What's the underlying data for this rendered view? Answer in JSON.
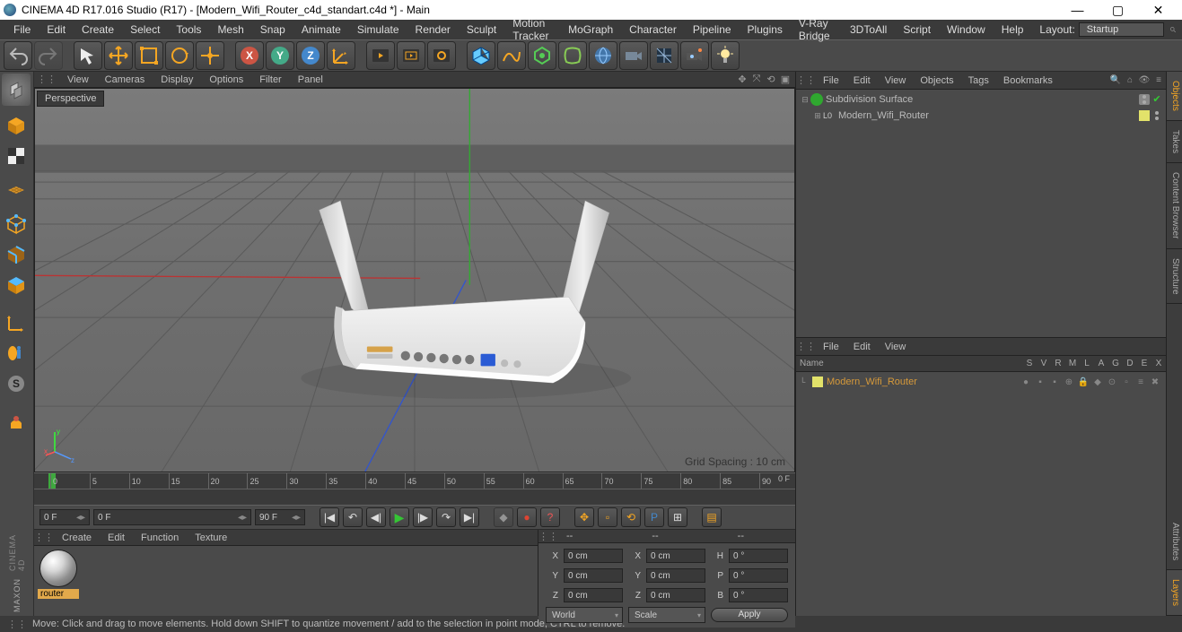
{
  "titlebar": {
    "text": "CINEMA 4D R17.016 Studio (R17) - [Modern_Wifi_Router_c4d_standart.c4d *] - Main"
  },
  "menubar": {
    "items": [
      "File",
      "Edit",
      "Create",
      "Select",
      "Tools",
      "Mesh",
      "Snap",
      "Animate",
      "Simulate",
      "Render",
      "Sculpt",
      "Motion Tracker",
      "MoGraph",
      "Character",
      "Pipeline",
      "Plugins",
      "V-Ray Bridge",
      "3DToAll",
      "Script",
      "Window",
      "Help"
    ],
    "layout_label": "Layout:",
    "layout_value": "Startup"
  },
  "viewport": {
    "menus": [
      "View",
      "Cameras",
      "Display",
      "Options",
      "Filter",
      "Panel"
    ],
    "label": "Perspective",
    "grid_info": "Grid Spacing : 10 cm"
  },
  "timeline": {
    "ticks": [
      "0",
      "5",
      "10",
      "15",
      "20",
      "25",
      "30",
      "35",
      "40",
      "45",
      "50",
      "55",
      "60",
      "65",
      "70",
      "75",
      "80",
      "85",
      "90"
    ],
    "end_label": "0 F",
    "frame_start": "0 F",
    "frame_slider": "0 F",
    "frame_end": "90 F"
  },
  "materials": {
    "menus": [
      "Create",
      "Edit",
      "Function",
      "Texture"
    ],
    "items": [
      {
        "name": "router"
      }
    ]
  },
  "coords": {
    "header": "--",
    "header2": "--",
    "header3": "--",
    "rows": [
      {
        "a": "X",
        "av": "0 cm",
        "b": "X",
        "bv": "0 cm",
        "c": "H",
        "cv": "0 °"
      },
      {
        "a": "Y",
        "av": "0 cm",
        "b": "Y",
        "bv": "0 cm",
        "c": "P",
        "cv": "0 °"
      },
      {
        "a": "Z",
        "av": "0 cm",
        "b": "Z",
        "bv": "0 cm",
        "c": "B",
        "cv": "0 °"
      }
    ],
    "drop1": "World",
    "drop2": "Scale",
    "apply": "Apply"
  },
  "obj_panel": {
    "menus": [
      "File",
      "Edit",
      "View",
      "Objects",
      "Tags",
      "Bookmarks"
    ],
    "tree": [
      {
        "indent": 0,
        "exp": "⊟",
        "icon": "subdiv",
        "name": "Subdivision Surface",
        "tags": [
          "phong",
          "check"
        ]
      },
      {
        "indent": 1,
        "exp": "⊞",
        "icon": "layer",
        "name": "Modern_Wifi_Router",
        "tags": [
          "yellow",
          "dot"
        ]
      }
    ]
  },
  "layer_panel": {
    "menus": [
      "File",
      "Edit",
      "View"
    ],
    "name_col": "Name",
    "cols": [
      "S",
      "V",
      "R",
      "M",
      "L",
      "A",
      "G",
      "D",
      "E",
      "X"
    ],
    "rows": [
      {
        "name": "Modern_Wifi_Router"
      }
    ]
  },
  "right_tabs": [
    "Objects",
    "Takes",
    "Content Browser",
    "Structure",
    "Attributes",
    "Layers"
  ],
  "right_tabs_active": [
    0,
    5
  ],
  "logo": {
    "brand": "MAXON",
    "prod": "CINEMA 4D"
  },
  "status": "Move: Click and drag to move elements. Hold down SHIFT to quantize movement / add to the selection in point mode, CTRL to remove."
}
